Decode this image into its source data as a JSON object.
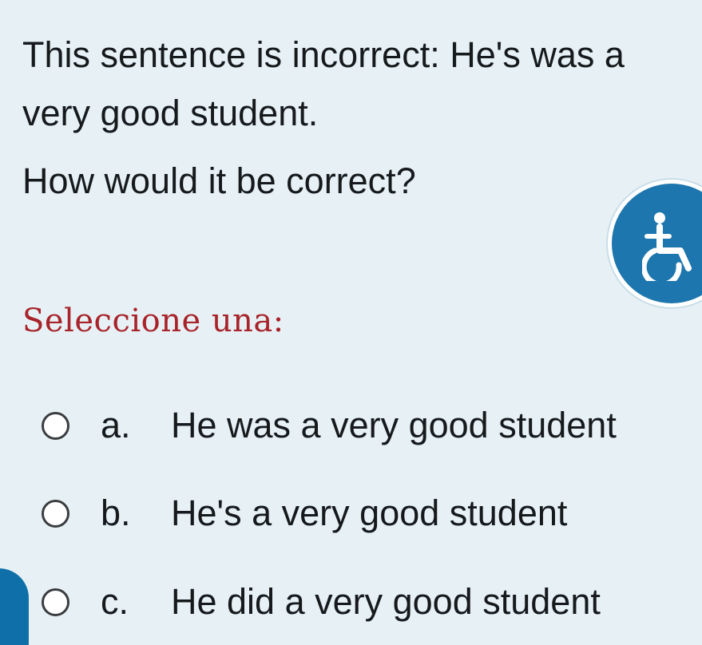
{
  "question": {
    "line1": "This sentence is incorrect: He's was a very good student.",
    "line2": "How would it be correct?"
  },
  "prompt": "Seleccione una:",
  "options": [
    {
      "letter": "a.",
      "text": "He was a very good student"
    },
    {
      "letter": "b.",
      "text": "He's a very good student"
    },
    {
      "letter": "c.",
      "text": "He did a very good student"
    }
  ],
  "icons": {
    "accessibility": "accessibility-icon"
  },
  "colors": {
    "background": "#e7f1f5",
    "prompt": "#a8232a",
    "accent": "#1d76ad"
  }
}
